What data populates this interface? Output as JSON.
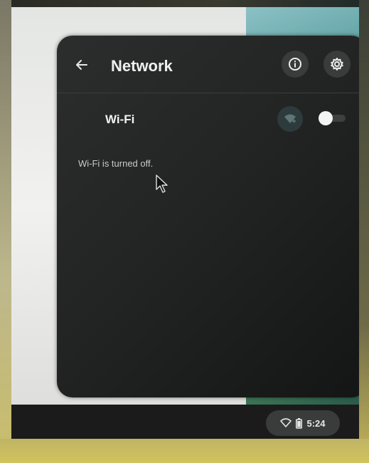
{
  "panel": {
    "title": "Network",
    "back_icon": "arrow-left-icon",
    "info_icon": "info-icon",
    "settings_icon": "gear-icon"
  },
  "wifi": {
    "label": "Wi-Fi",
    "add_network_icon": "wifi-add-icon",
    "toggle_state": "on",
    "status_text": "Wi-Fi is turned off."
  },
  "tray": {
    "wifi_icon": "wifi-icon",
    "battery_icon": "battery-icon",
    "time": "5:24"
  },
  "colors": {
    "panel_bg": "#232424",
    "text_primary": "#f0f0f0",
    "text_secondary": "#c9c9c9",
    "button_bg": "#3a3b3b"
  }
}
